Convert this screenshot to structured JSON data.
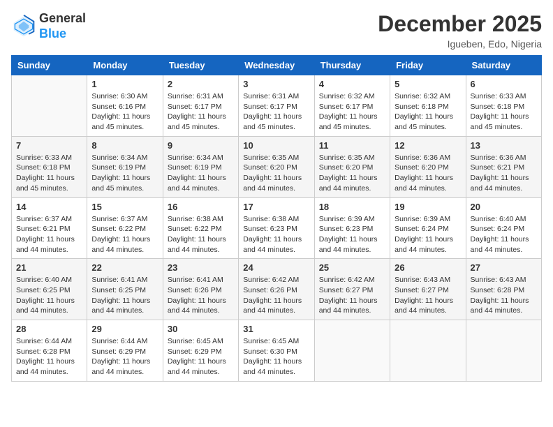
{
  "logo": {
    "general": "General",
    "blue": "Blue"
  },
  "title": "December 2025",
  "location": "Igueben, Edo, Nigeria",
  "days_of_week": [
    "Sunday",
    "Monday",
    "Tuesday",
    "Wednesday",
    "Thursday",
    "Friday",
    "Saturday"
  ],
  "weeks": [
    [
      {
        "day": "",
        "info": ""
      },
      {
        "day": "1",
        "info": "Sunrise: 6:30 AM\nSunset: 6:16 PM\nDaylight: 11 hours and 45 minutes."
      },
      {
        "day": "2",
        "info": "Sunrise: 6:31 AM\nSunset: 6:17 PM\nDaylight: 11 hours and 45 minutes."
      },
      {
        "day": "3",
        "info": "Sunrise: 6:31 AM\nSunset: 6:17 PM\nDaylight: 11 hours and 45 minutes."
      },
      {
        "day": "4",
        "info": "Sunrise: 6:32 AM\nSunset: 6:17 PM\nDaylight: 11 hours and 45 minutes."
      },
      {
        "day": "5",
        "info": "Sunrise: 6:32 AM\nSunset: 6:18 PM\nDaylight: 11 hours and 45 minutes."
      },
      {
        "day": "6",
        "info": "Sunrise: 6:33 AM\nSunset: 6:18 PM\nDaylight: 11 hours and 45 minutes."
      }
    ],
    [
      {
        "day": "7",
        "info": "Sunrise: 6:33 AM\nSunset: 6:18 PM\nDaylight: 11 hours and 45 minutes."
      },
      {
        "day": "8",
        "info": "Sunrise: 6:34 AM\nSunset: 6:19 PM\nDaylight: 11 hours and 45 minutes."
      },
      {
        "day": "9",
        "info": "Sunrise: 6:34 AM\nSunset: 6:19 PM\nDaylight: 11 hours and 44 minutes."
      },
      {
        "day": "10",
        "info": "Sunrise: 6:35 AM\nSunset: 6:20 PM\nDaylight: 11 hours and 44 minutes."
      },
      {
        "day": "11",
        "info": "Sunrise: 6:35 AM\nSunset: 6:20 PM\nDaylight: 11 hours and 44 minutes."
      },
      {
        "day": "12",
        "info": "Sunrise: 6:36 AM\nSunset: 6:20 PM\nDaylight: 11 hours and 44 minutes."
      },
      {
        "day": "13",
        "info": "Sunrise: 6:36 AM\nSunset: 6:21 PM\nDaylight: 11 hours and 44 minutes."
      }
    ],
    [
      {
        "day": "14",
        "info": "Sunrise: 6:37 AM\nSunset: 6:21 PM\nDaylight: 11 hours and 44 minutes."
      },
      {
        "day": "15",
        "info": "Sunrise: 6:37 AM\nSunset: 6:22 PM\nDaylight: 11 hours and 44 minutes."
      },
      {
        "day": "16",
        "info": "Sunrise: 6:38 AM\nSunset: 6:22 PM\nDaylight: 11 hours and 44 minutes."
      },
      {
        "day": "17",
        "info": "Sunrise: 6:38 AM\nSunset: 6:23 PM\nDaylight: 11 hours and 44 minutes."
      },
      {
        "day": "18",
        "info": "Sunrise: 6:39 AM\nSunset: 6:23 PM\nDaylight: 11 hours and 44 minutes."
      },
      {
        "day": "19",
        "info": "Sunrise: 6:39 AM\nSunset: 6:24 PM\nDaylight: 11 hours and 44 minutes."
      },
      {
        "day": "20",
        "info": "Sunrise: 6:40 AM\nSunset: 6:24 PM\nDaylight: 11 hours and 44 minutes."
      }
    ],
    [
      {
        "day": "21",
        "info": "Sunrise: 6:40 AM\nSunset: 6:25 PM\nDaylight: 11 hours and 44 minutes."
      },
      {
        "day": "22",
        "info": "Sunrise: 6:41 AM\nSunset: 6:25 PM\nDaylight: 11 hours and 44 minutes."
      },
      {
        "day": "23",
        "info": "Sunrise: 6:41 AM\nSunset: 6:26 PM\nDaylight: 11 hours and 44 minutes."
      },
      {
        "day": "24",
        "info": "Sunrise: 6:42 AM\nSunset: 6:26 PM\nDaylight: 11 hours and 44 minutes."
      },
      {
        "day": "25",
        "info": "Sunrise: 6:42 AM\nSunset: 6:27 PM\nDaylight: 11 hours and 44 minutes."
      },
      {
        "day": "26",
        "info": "Sunrise: 6:43 AM\nSunset: 6:27 PM\nDaylight: 11 hours and 44 minutes."
      },
      {
        "day": "27",
        "info": "Sunrise: 6:43 AM\nSunset: 6:28 PM\nDaylight: 11 hours and 44 minutes."
      }
    ],
    [
      {
        "day": "28",
        "info": "Sunrise: 6:44 AM\nSunset: 6:28 PM\nDaylight: 11 hours and 44 minutes."
      },
      {
        "day": "29",
        "info": "Sunrise: 6:44 AM\nSunset: 6:29 PM\nDaylight: 11 hours and 44 minutes."
      },
      {
        "day": "30",
        "info": "Sunrise: 6:45 AM\nSunset: 6:29 PM\nDaylight: 11 hours and 44 minutes."
      },
      {
        "day": "31",
        "info": "Sunrise: 6:45 AM\nSunset: 6:30 PM\nDaylight: 11 hours and 44 minutes."
      },
      {
        "day": "",
        "info": ""
      },
      {
        "day": "",
        "info": ""
      },
      {
        "day": "",
        "info": ""
      }
    ]
  ]
}
